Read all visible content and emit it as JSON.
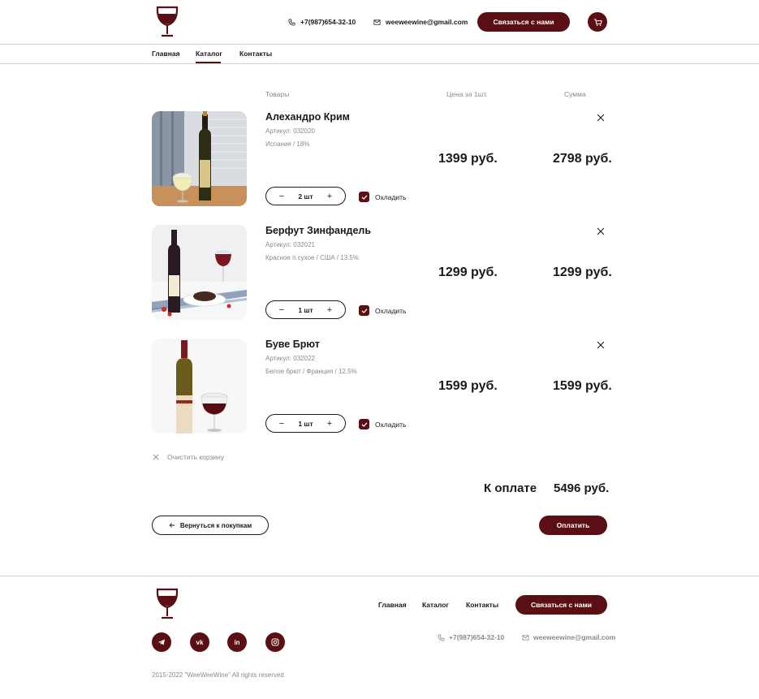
{
  "header": {
    "phone": "+7(987)654-32-10",
    "email": "weeweewine@gmail.com",
    "contact_button": "Связаться с нами",
    "cart_icon": "cart-icon"
  },
  "nav": {
    "items": [
      "Главная",
      "Каталог",
      "Контакты"
    ],
    "active": "Каталог"
  },
  "cart": {
    "columns": [
      "Товары",
      "Цена за 1шт.",
      "Сумма"
    ],
    "items": [
      {
        "title": "Алехандро Крим",
        "sku": "Артикул: 032020",
        "details": "Испания / 18%",
        "qty": "2 шт",
        "chill_label": "Охладить",
        "chilled": true,
        "price": "1399 руб.",
        "sum": "2798 руб."
      },
      {
        "title": "Берфут Зинфандель",
        "sku": "Артикул: 032021",
        "details": "Красное п.сухое / США / 13.5%",
        "qty": "1 шт",
        "chill_label": "Охладить",
        "chilled": true,
        "price": "1299 руб.",
        "sum": "1299 руб."
      },
      {
        "title": "Буве Брют",
        "sku": "Артикул: 032022",
        "details": "Белое брют / Франция / 12.5%",
        "qty": "1 шт",
        "chill_label": "Охладить",
        "chilled": true,
        "price": "1599 руб.",
        "sum": "1599 руб."
      }
    ],
    "clear_label": "Очистить корзину",
    "total_label": "К оплате",
    "total_value": "5496 руб.",
    "back_button": "Вернуться к покупкам",
    "pay_button": "Оплатить"
  },
  "footer": {
    "nav": [
      "Главная",
      "Каталог",
      "Контакты"
    ],
    "contact_button": "Связаться с нами",
    "phone": "+7(987)654-32-10",
    "email": "weeweewine@gmail.com",
    "socials": [
      "telegram-icon",
      "vk-icon",
      "linkedin-icon",
      "instagram-icon"
    ],
    "copyright": "2015-2022 \"WeeWeeWine\" All rights reserved"
  },
  "colors": {
    "accent": "#5a0f14",
    "muted_text": "#8a8a8a",
    "divider": "#cfcfcf"
  }
}
